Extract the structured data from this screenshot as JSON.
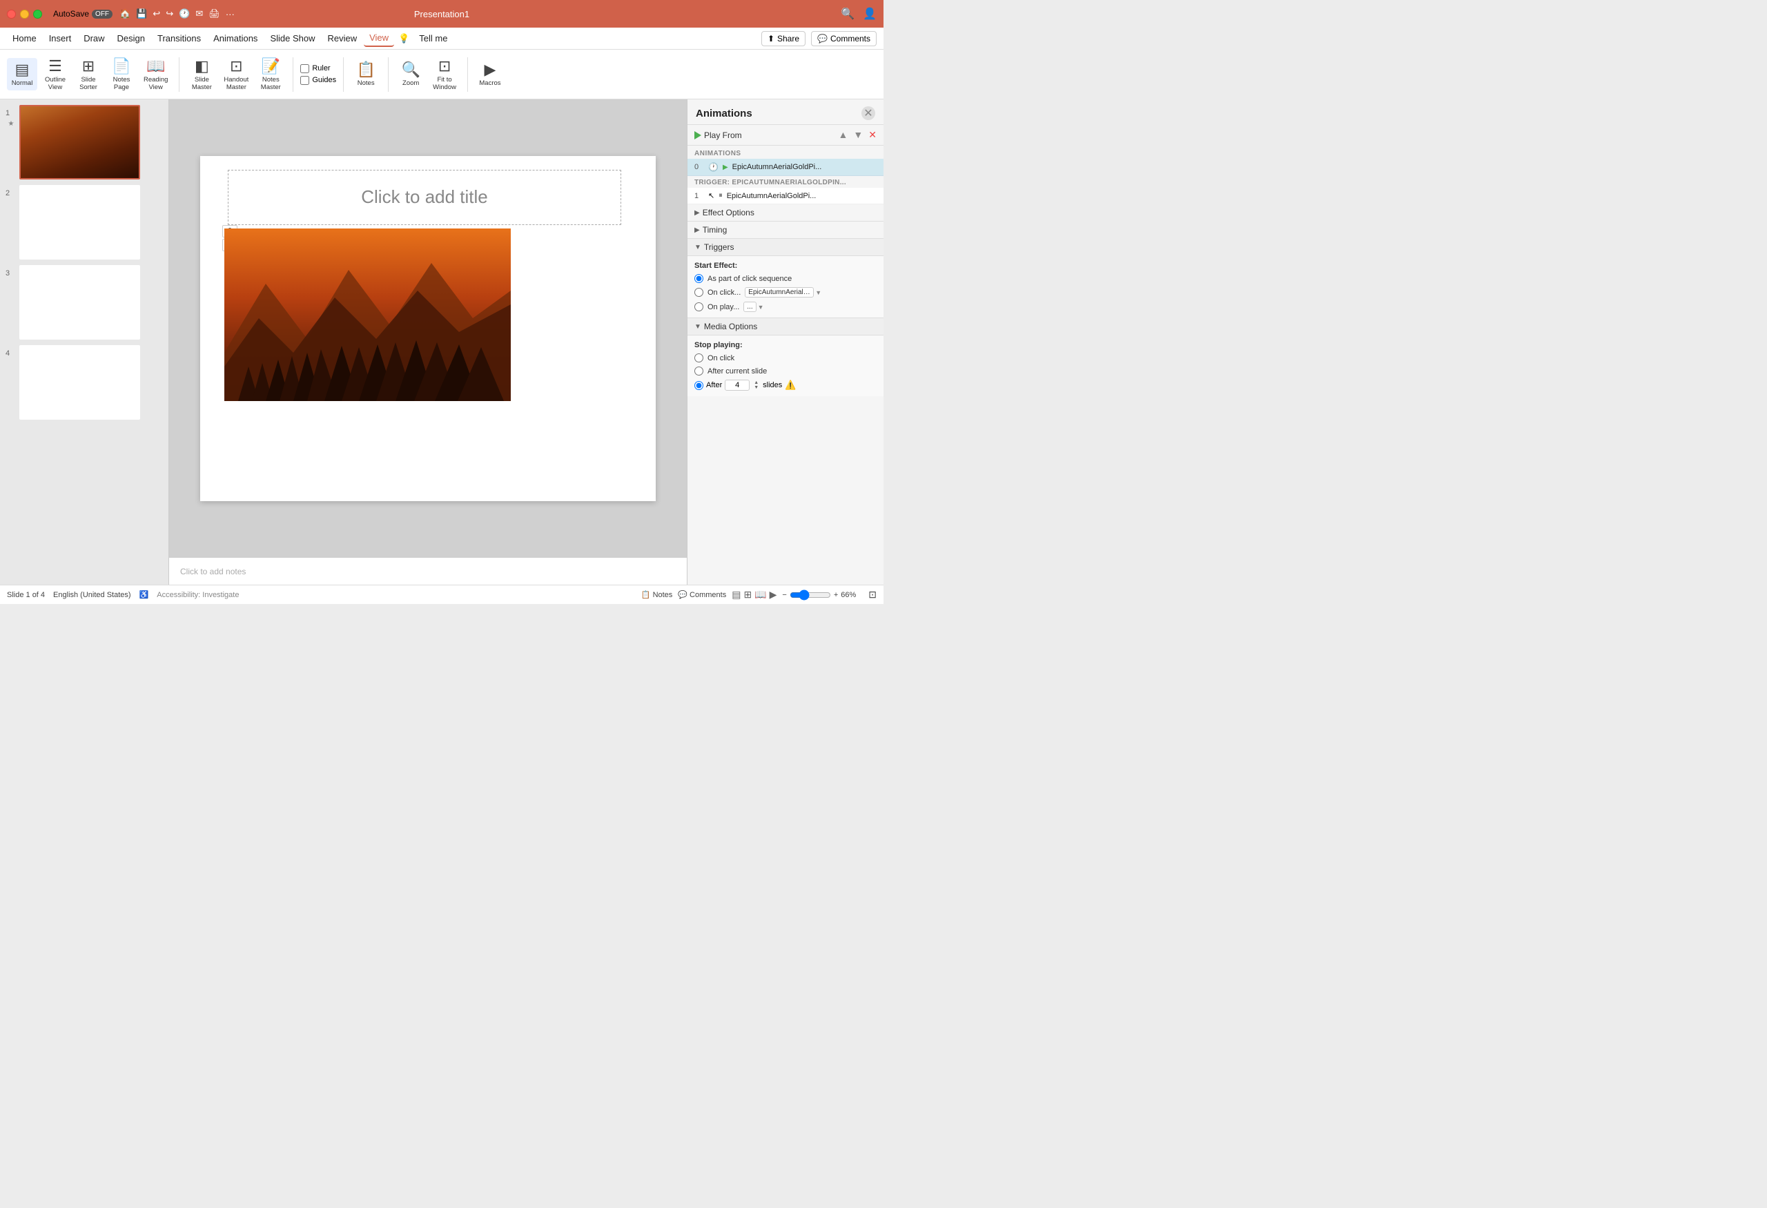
{
  "titlebar": {
    "title": "Presentation1",
    "autosave": "AutoSave",
    "autosave_off": "OFF"
  },
  "menubar": {
    "items": [
      "Home",
      "Insert",
      "Draw",
      "Design",
      "Transitions",
      "Animations",
      "Slide Show",
      "Review",
      "View",
      "Tell me"
    ],
    "active": "View",
    "share": "Share",
    "comments": "Comments"
  },
  "ribbon": {
    "view_buttons": [
      {
        "id": "normal",
        "label": "Normal",
        "icon": "▤"
      },
      {
        "id": "outline-view",
        "label": "Outline View",
        "icon": "☰"
      },
      {
        "id": "slide-sorter",
        "label": "Slide Sorter",
        "icon": "⊞"
      },
      {
        "id": "notes-page",
        "label": "Notes Page",
        "icon": "📄"
      },
      {
        "id": "reading-view",
        "label": "Reading View",
        "icon": "📖"
      }
    ],
    "master_buttons": [
      {
        "id": "slide-master",
        "label": "Slide Master",
        "icon": "◧"
      },
      {
        "id": "handout-master",
        "label": "Handout Master",
        "icon": "⊡"
      },
      {
        "id": "notes-master",
        "label": "Notes Master",
        "icon": "📝"
      }
    ],
    "checkboxes": [
      {
        "label": "Ruler",
        "checked": false
      },
      {
        "label": "Guides",
        "checked": false
      }
    ],
    "action_buttons": [
      {
        "id": "notes",
        "label": "Notes",
        "icon": "📋"
      },
      {
        "id": "zoom",
        "label": "Zoom",
        "icon": "🔍"
      },
      {
        "id": "fit-to-window",
        "label": "Fit to Window",
        "icon": "⊡"
      },
      {
        "id": "macros",
        "label": "Macros",
        "icon": "▶"
      }
    ]
  },
  "slides": [
    {
      "num": 1,
      "has_image": true,
      "selected": true,
      "has_star": true
    },
    {
      "num": 2,
      "has_image": false,
      "selected": false,
      "has_star": false
    },
    {
      "num": 3,
      "has_image": false,
      "selected": false,
      "has_star": false
    },
    {
      "num": 4,
      "has_image": false,
      "selected": false,
      "has_star": false
    }
  ],
  "slide": {
    "title_placeholder": "Click to add title",
    "notes_placeholder": "Click to add notes",
    "animation_badge_0": "0",
    "animation_badge_1": "⚡"
  },
  "animations_panel": {
    "title": "Animations",
    "play_label": "Play From",
    "section_label": "ANIMATIONS",
    "anim_0_num": "0",
    "anim_0_name": "EpicAutumnAerialGoldPi...",
    "trigger_label": "TRIGGER: EPICAUTUMNAERIALGOLDPIN...",
    "trigger_1_num": "1",
    "trigger_1_name": "EpicAutumnAerialGoldPi...",
    "effect_options": "Effect Options",
    "timing": "Timing",
    "triggers": "Triggers",
    "start_effect": "Start Effect:",
    "radio_sequence": "As part of click sequence",
    "radio_on_click": "On click...",
    "on_click_value": "EpicAutumnAerialGoldPinkPine...",
    "radio_on_play": "On play...",
    "media_options": "Media Options",
    "stop_playing": "Stop playing:",
    "on_click_stop": "On click",
    "after_current_slide": "After current slide",
    "after_label": "After",
    "after_value": "4",
    "slides_label": "slides"
  },
  "statusbar": {
    "slide_info": "Slide 1 of 4",
    "language": "English (United States)",
    "accessibility": "Accessibility: Investigate",
    "notes": "Notes",
    "comments": "Comments",
    "zoom": "66%"
  }
}
